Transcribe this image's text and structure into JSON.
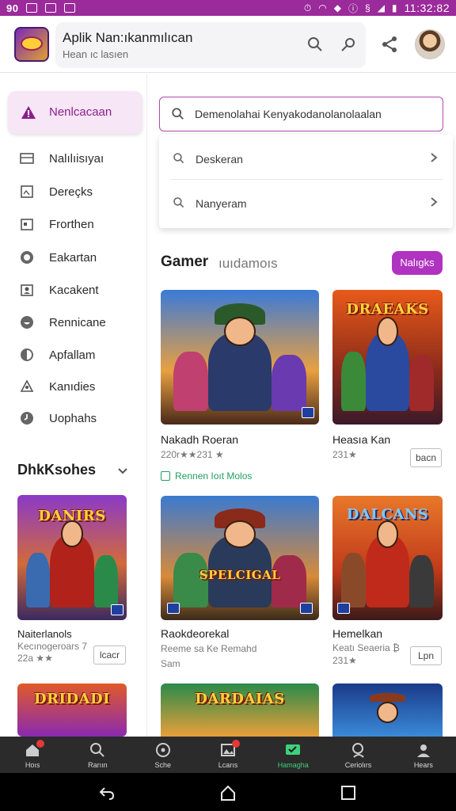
{
  "status_bar": {
    "left_time": "90",
    "clock": "11:32:82"
  },
  "header": {
    "title": "Aplik Nan:ıkanmılıcan",
    "subtitle": "Hean ıc lasıen",
    "icons": [
      "app-logo",
      "search-icon",
      "mic-icon",
      "share-icon",
      "avatar"
    ]
  },
  "sidebar": {
    "active_item": {
      "label": "Nenlcacaan",
      "icon": "warning-triangle-icon"
    },
    "items": [
      {
        "label": "Nalılıisıyaı",
        "icon": "square-icon"
      },
      {
        "label": "Dereçks",
        "icon": "image-icon"
      },
      {
        "label": "Frorthen",
        "icon": "calendar-icon"
      },
      {
        "label": "Eakartan",
        "icon": "circle-icon"
      },
      {
        "label": "Kacakent",
        "icon": "user-badge-icon"
      },
      {
        "label": "Rennicane",
        "icon": "smile-circle-icon"
      },
      {
        "label": "Apfallam",
        "icon": "half-circle-icon"
      },
      {
        "label": "Kanıdies",
        "icon": "person-icon"
      },
      {
        "label": "Uophahs",
        "icon": "clock-icon"
      }
    ],
    "section_title": "DhkKsohes",
    "cards": [
      {
        "title": "Naiterlanols",
        "sub1": "Kecınogeroars 7",
        "sub2": "22a ★★",
        "button": "lcacr",
        "art_text": "DANIRS"
      },
      {
        "title": "",
        "sub1": "",
        "sub2": "",
        "button": "",
        "art_text": "DRIDADI"
      }
    ]
  },
  "search": {
    "value": "Demenolahai Kenyakodanolanolaalan",
    "placeholder": "Search",
    "suggestions": [
      {
        "label": "Deskeran"
      },
      {
        "label": "Nanyeram"
      }
    ]
  },
  "games": {
    "title": "Gamer",
    "subtitle": "ıuıdamoıs",
    "button": "Nalıgks",
    "promo": "Rennen Ioıt Molos",
    "cards": [
      {
        "title": "Nakadh Roeran",
        "meta": "220r★★231 ★",
        "button": "",
        "art_text": ""
      },
      {
        "title": "Heasıa Kan",
        "meta": "231★",
        "button": "bacn",
        "art_text": "DRAEAKS"
      },
      {
        "title": "Raokdeorekal",
        "meta": "Reeme sa Ke Remahd",
        "meta2": "Sam",
        "button": "",
        "art_text": "SPELCIGAL"
      },
      {
        "title": "Hemelkan",
        "meta": "Keatı Seaeria ₿",
        "meta2": "231★",
        "button": "Lpn",
        "art_text": "DALCANS"
      },
      {
        "title": "",
        "meta": "",
        "button": "",
        "art_text": "DARDAIAS"
      },
      {
        "title": "",
        "meta": "",
        "button": "",
        "art_text": ""
      }
    ]
  },
  "bottom_nav": [
    {
      "label": "Hoıs",
      "icon": "home-icon",
      "badge": true
    },
    {
      "label": "Rarıın",
      "icon": "search-icon",
      "badge": false
    },
    {
      "label": "Sche",
      "icon": "target-icon",
      "badge": false
    },
    {
      "label": "Lcarıs",
      "icon": "gallery-icon",
      "badge": true
    },
    {
      "label": "Hamagha",
      "icon": "chat-check-icon",
      "badge": false,
      "active": true
    },
    {
      "label": "Ceriolırs",
      "icon": "search-person-icon",
      "badge": false
    },
    {
      "label": "Hears",
      "icon": "profile-icon",
      "badge": false
    }
  ],
  "colors": {
    "accent": "#b032c0",
    "status_bar": "#9b2a9b",
    "active_nav": "#3ed07a",
    "nav_bg": "#2b2b2b"
  }
}
